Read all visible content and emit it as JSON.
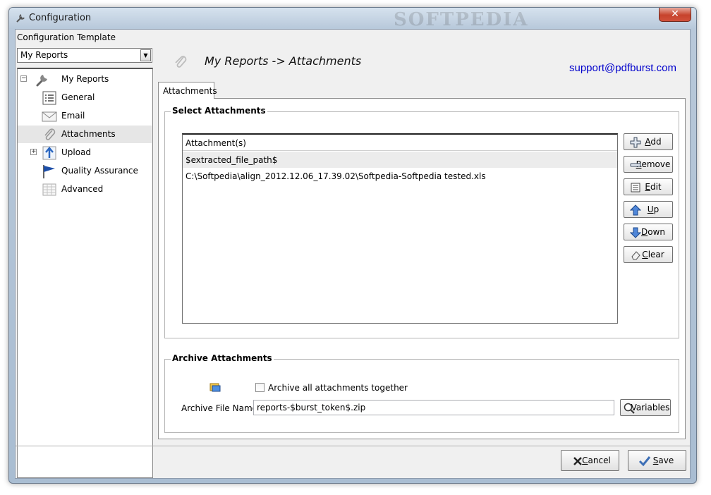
{
  "window": {
    "title": "Configuration",
    "watermark": "SOFTPEDIA",
    "close_glyph": "✕"
  },
  "sidebar": {
    "template_label": "Configuration Template",
    "template_selected": "My Reports",
    "tree": [
      {
        "label": "My Reports",
        "icon": "wrench-icon",
        "expander": "⊟"
      },
      {
        "label": "General",
        "icon": "list-icon"
      },
      {
        "label": "Email",
        "icon": "envelope-icon"
      },
      {
        "label": "Attachments",
        "icon": "paperclip-icon",
        "selected": true
      },
      {
        "label": "Upload",
        "icon": "upload-arrow-icon",
        "expander": "+"
      },
      {
        "label": "Quality Assurance",
        "icon": "flag-icon"
      },
      {
        "label": "Advanced",
        "icon": "grid-icon"
      }
    ]
  },
  "header": {
    "title": "My Reports -> Attachments",
    "support_email": "support@pdfburst.com"
  },
  "tabs": [
    {
      "label": "Attachments"
    }
  ],
  "select_attachments": {
    "title": "Select Attachments",
    "column_header": "Attachment(s)",
    "rows": [
      "$extracted_file_path$",
      "C:\\Softpedia\\align_2012.12.06_17.39.02\\Softpedia-Softpedia tested.xls"
    ],
    "buttons": {
      "add": {
        "mn": "A",
        "rest": "dd"
      },
      "remove": {
        "mn": "R",
        "rest": "emove"
      },
      "edit": {
        "mn": "E",
        "rest": "dit"
      },
      "up": {
        "mn": "U",
        "rest": "p"
      },
      "down": {
        "mn": "D",
        "rest": "own"
      },
      "clear": {
        "mn": "C",
        "rest": "lear"
      }
    }
  },
  "archive": {
    "title": "Archive Attachments",
    "checkbox_label": "Archive all attachments together",
    "checked": false,
    "file_name_label": "Archive File Name",
    "file_name_value": "reports-$burst_token$.zip",
    "variables_button": "Variables"
  },
  "footer": {
    "cancel": {
      "mn": "C",
      "rest": "ancel"
    },
    "save": {
      "mn": "S",
      "rest": "ave"
    }
  },
  "colors": {
    "link": "#0000cc",
    "close": "#c7432c",
    "selection": "#e6e6e6"
  }
}
